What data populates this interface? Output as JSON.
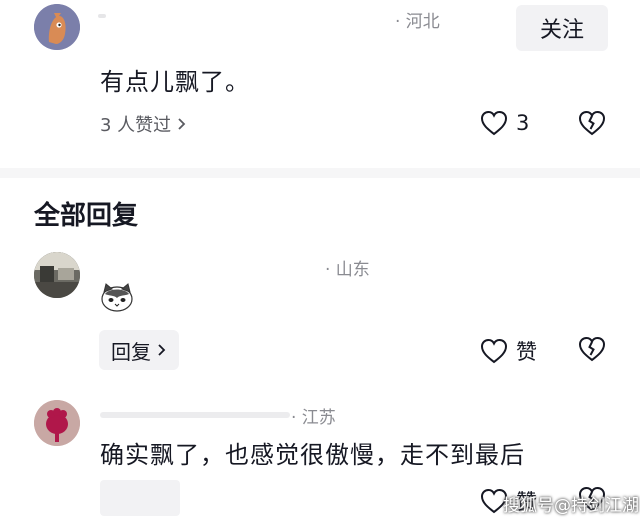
{
  "comments": [
    {
      "location": "· 河北",
      "follow_label": "关注",
      "text": "有点儿飘了。",
      "liked_by": "3 人赞过",
      "like_count": "3"
    },
    {
      "location": "· 山东",
      "sticker": "cat-sticker",
      "reply_label": "回复",
      "like_label": "赞"
    },
    {
      "location": "· 江苏",
      "text": "确实飘了，也感觉很傲慢，走不到最后",
      "like_label": "赞"
    }
  ],
  "section_title": "全部回复",
  "watermark": "搜狐号@持剑江湖",
  "colors": {
    "text": "#161823",
    "secondary": "#8a8b91",
    "pill_bg": "#f2f2f4",
    "divider": "#f6f6f7"
  }
}
